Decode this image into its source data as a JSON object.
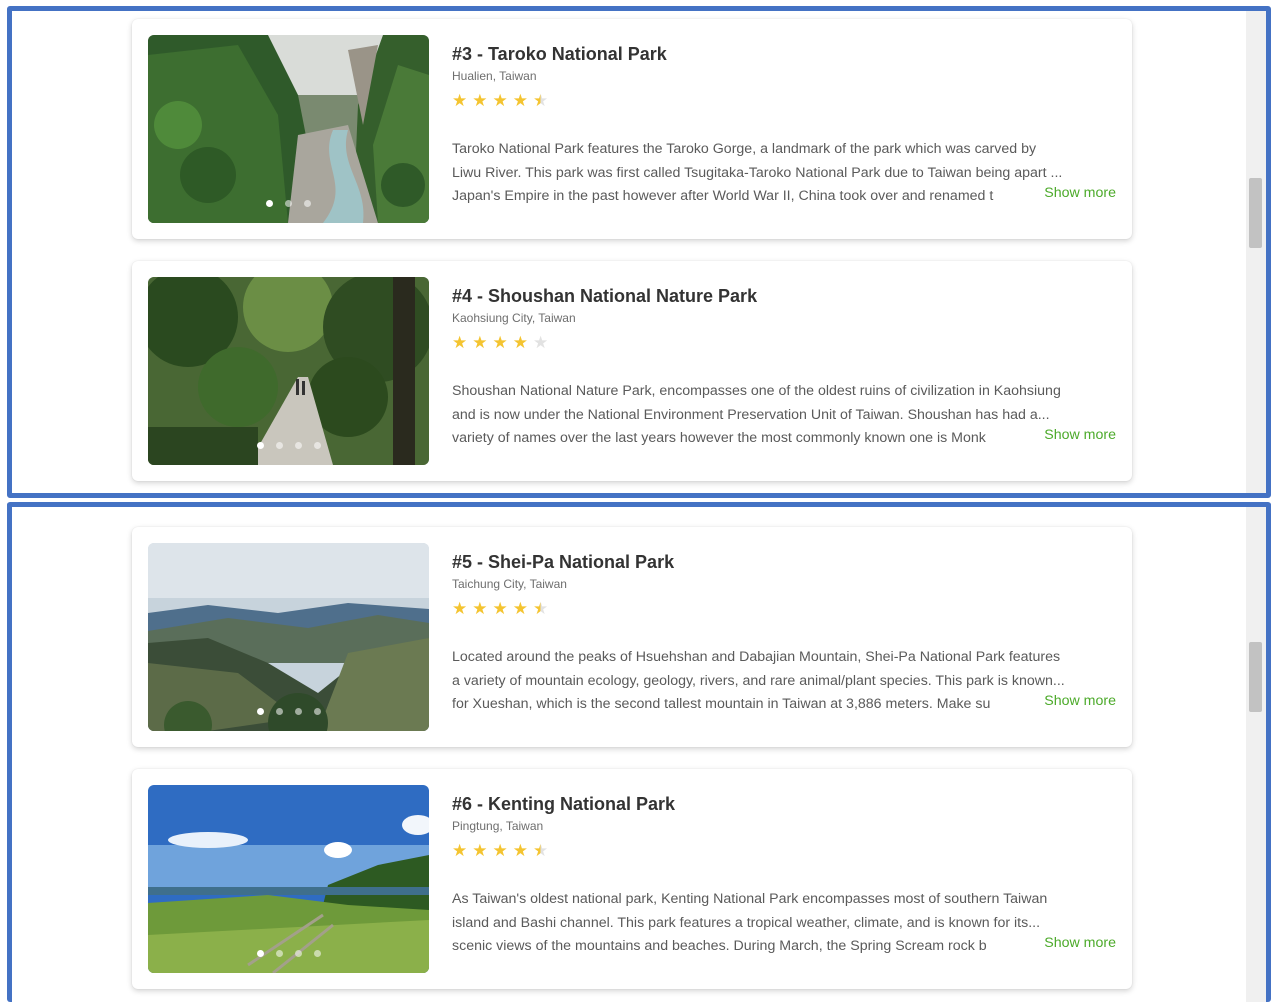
{
  "colors": {
    "panel_border": "#4472c4",
    "star": "#f4c430",
    "star_empty": "#e2e2e2",
    "link": "#4caa2a",
    "title": "#333333"
  },
  "show_more_label": "Show more",
  "parks": [
    {
      "title": "#3 - Taroko National Park",
      "location": "Hualien, Taiwan",
      "rating": 4.5,
      "image": "gorge-with-river",
      "lines": [
        "Taroko National Park features the Taroko Gorge, a landmark of the park which was carved by",
        "Liwu River. This park was first called Tsugitaka-Taroko National Park due to Taiwan being apart ...",
        "Japan's Empire in the past however after World War II, China took over and renamed t"
      ]
    },
    {
      "title": "#4 - Shoushan National Nature Park",
      "location": "Kaohsiung City, Taiwan",
      "rating": 4,
      "image": "forest-trail",
      "lines": [
        "Shoushan National Nature Park, encompasses one of the oldest ruins of civilization in Kaohsiung",
        "and is now under the National Environment Preservation Unit of Taiwan. Shoushan has had a...",
        "variety of names over the last years however the most commonly known one is Monk"
      ]
    },
    {
      "title": "#5 - Shei-Pa National Park",
      "location": "Taichung City, Taiwan",
      "rating": 4.5,
      "image": "mountain-ridges",
      "lines": [
        "Located around the peaks of Hsuehshan and Dabajian Mountain, Shei-Pa National Park features",
        "a variety of mountain ecology, geology, rivers, and rare animal/plant species. This park is known...",
        "for Xueshan, which is the second tallest mountain in Taiwan at 3,886 meters. Make su"
      ]
    },
    {
      "title": "#6 - Kenting National Park",
      "location": "Pingtung, Taiwan",
      "rating": 4.5,
      "image": "grassland-and-sky",
      "lines": [
        "As Taiwan's oldest national park, Kenting National Park encompasses most of southern Taiwan",
        "island and Bashi channel. This park features a tropical weather, climate, and is known for its...",
        "scenic views of the mountains and beaches. During March, the Spring Scream rock b"
      ]
    }
  ]
}
